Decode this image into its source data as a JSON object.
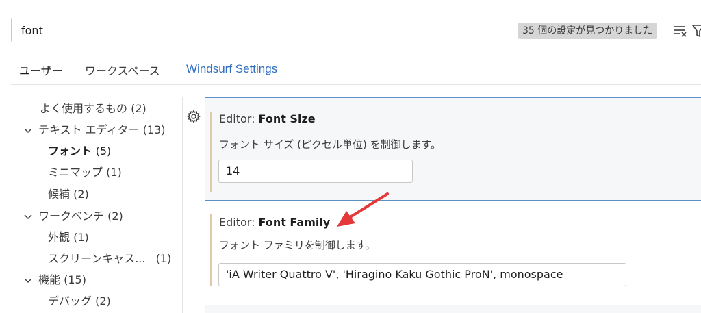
{
  "search": {
    "value": "font",
    "result_count_badge": "35 個の設定が見つかりました"
  },
  "tabs": [
    {
      "label": "ユーザー"
    },
    {
      "label": "ワークスペース"
    },
    {
      "label": "Windsurf Settings"
    }
  ],
  "tree": {
    "common": {
      "label": "よく使用するもの",
      "count": "(2)"
    },
    "text_editor": {
      "label": "テキスト エディター",
      "count": "(13)"
    },
    "font": {
      "label": "フォント",
      "count": "(5)"
    },
    "minimap": {
      "label": "ミニマップ",
      "count": "(1)"
    },
    "suggest": {
      "label": "候補",
      "count": "(2)"
    },
    "workbench": {
      "label": "ワークベンチ",
      "count": "(2)"
    },
    "appearance": {
      "label": "外観",
      "count": "(1)"
    },
    "screencast": {
      "label": "スクリーンキャス...",
      "count": "(1)"
    },
    "features": {
      "label": "機能",
      "count": "(15)"
    },
    "debug": {
      "label": "デバッグ",
      "count": "(2)"
    }
  },
  "settings": [
    {
      "category": "Editor: ",
      "name": "Font Size",
      "description": "フォント サイズ (ピクセル単位) を制御します。",
      "value": "14"
    },
    {
      "category": "Editor: ",
      "name": "Font Family",
      "description": "フォント ファミリを制御します。",
      "value": "'iA Writer Quattro V', 'Hiragino Kaku Gothic ProN', monospace"
    }
  ],
  "colors": {
    "accent_link": "#2f6ec0",
    "focus_border": "#5f8ec0",
    "modified_indicator": "#dfc9a6",
    "annotation_arrow": "#e5383b"
  }
}
